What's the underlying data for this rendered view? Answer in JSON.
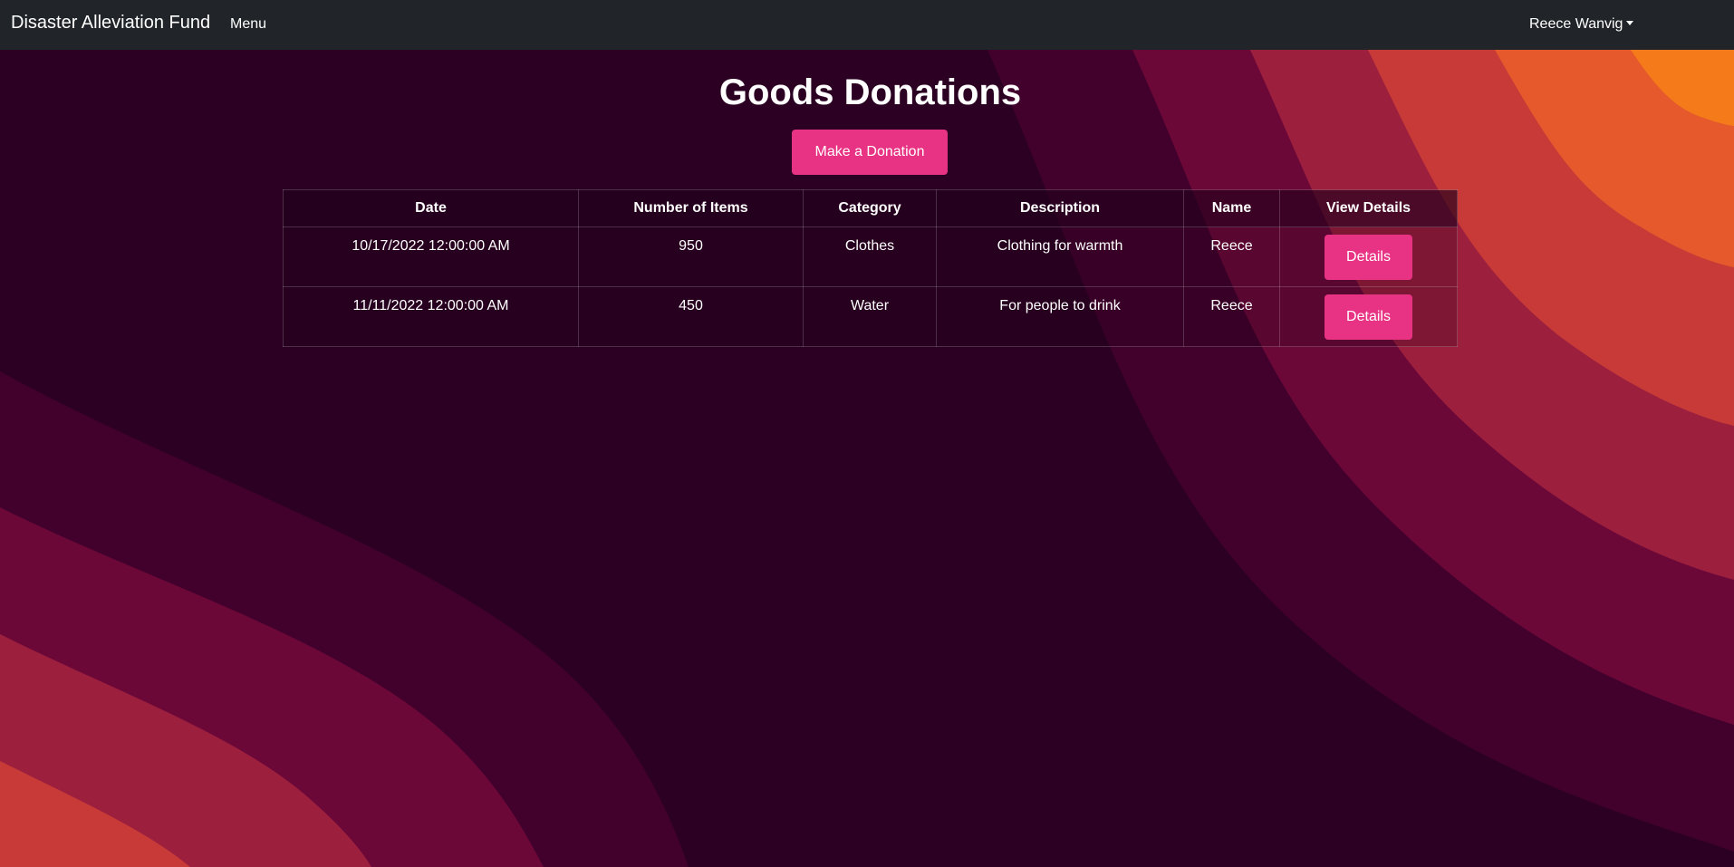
{
  "navbar": {
    "brand": "Disaster Alleviation Fund",
    "menu_label": "Menu",
    "user_label": "Reece Wanvig"
  },
  "page": {
    "title": "Goods Donations",
    "donate_button": "Make a Donation"
  },
  "table": {
    "headers": [
      "Date",
      "Number of Items",
      "Category",
      "Description",
      "Name",
      "View Details"
    ],
    "rows": [
      {
        "date": "10/17/2022 12:00:00 AM",
        "items": "950",
        "category": "Clothes",
        "description": "Clothing for warmth",
        "name": "Reece",
        "action": "Details"
      },
      {
        "date": "11/11/2022 12:00:00 AM",
        "items": "450",
        "category": "Water",
        "description": "For people to drink",
        "name": "Reece",
        "action": "Details"
      }
    ]
  },
  "colors": {
    "navbar": "#212529",
    "accent": "#e83283",
    "background": "#2b0022"
  }
}
